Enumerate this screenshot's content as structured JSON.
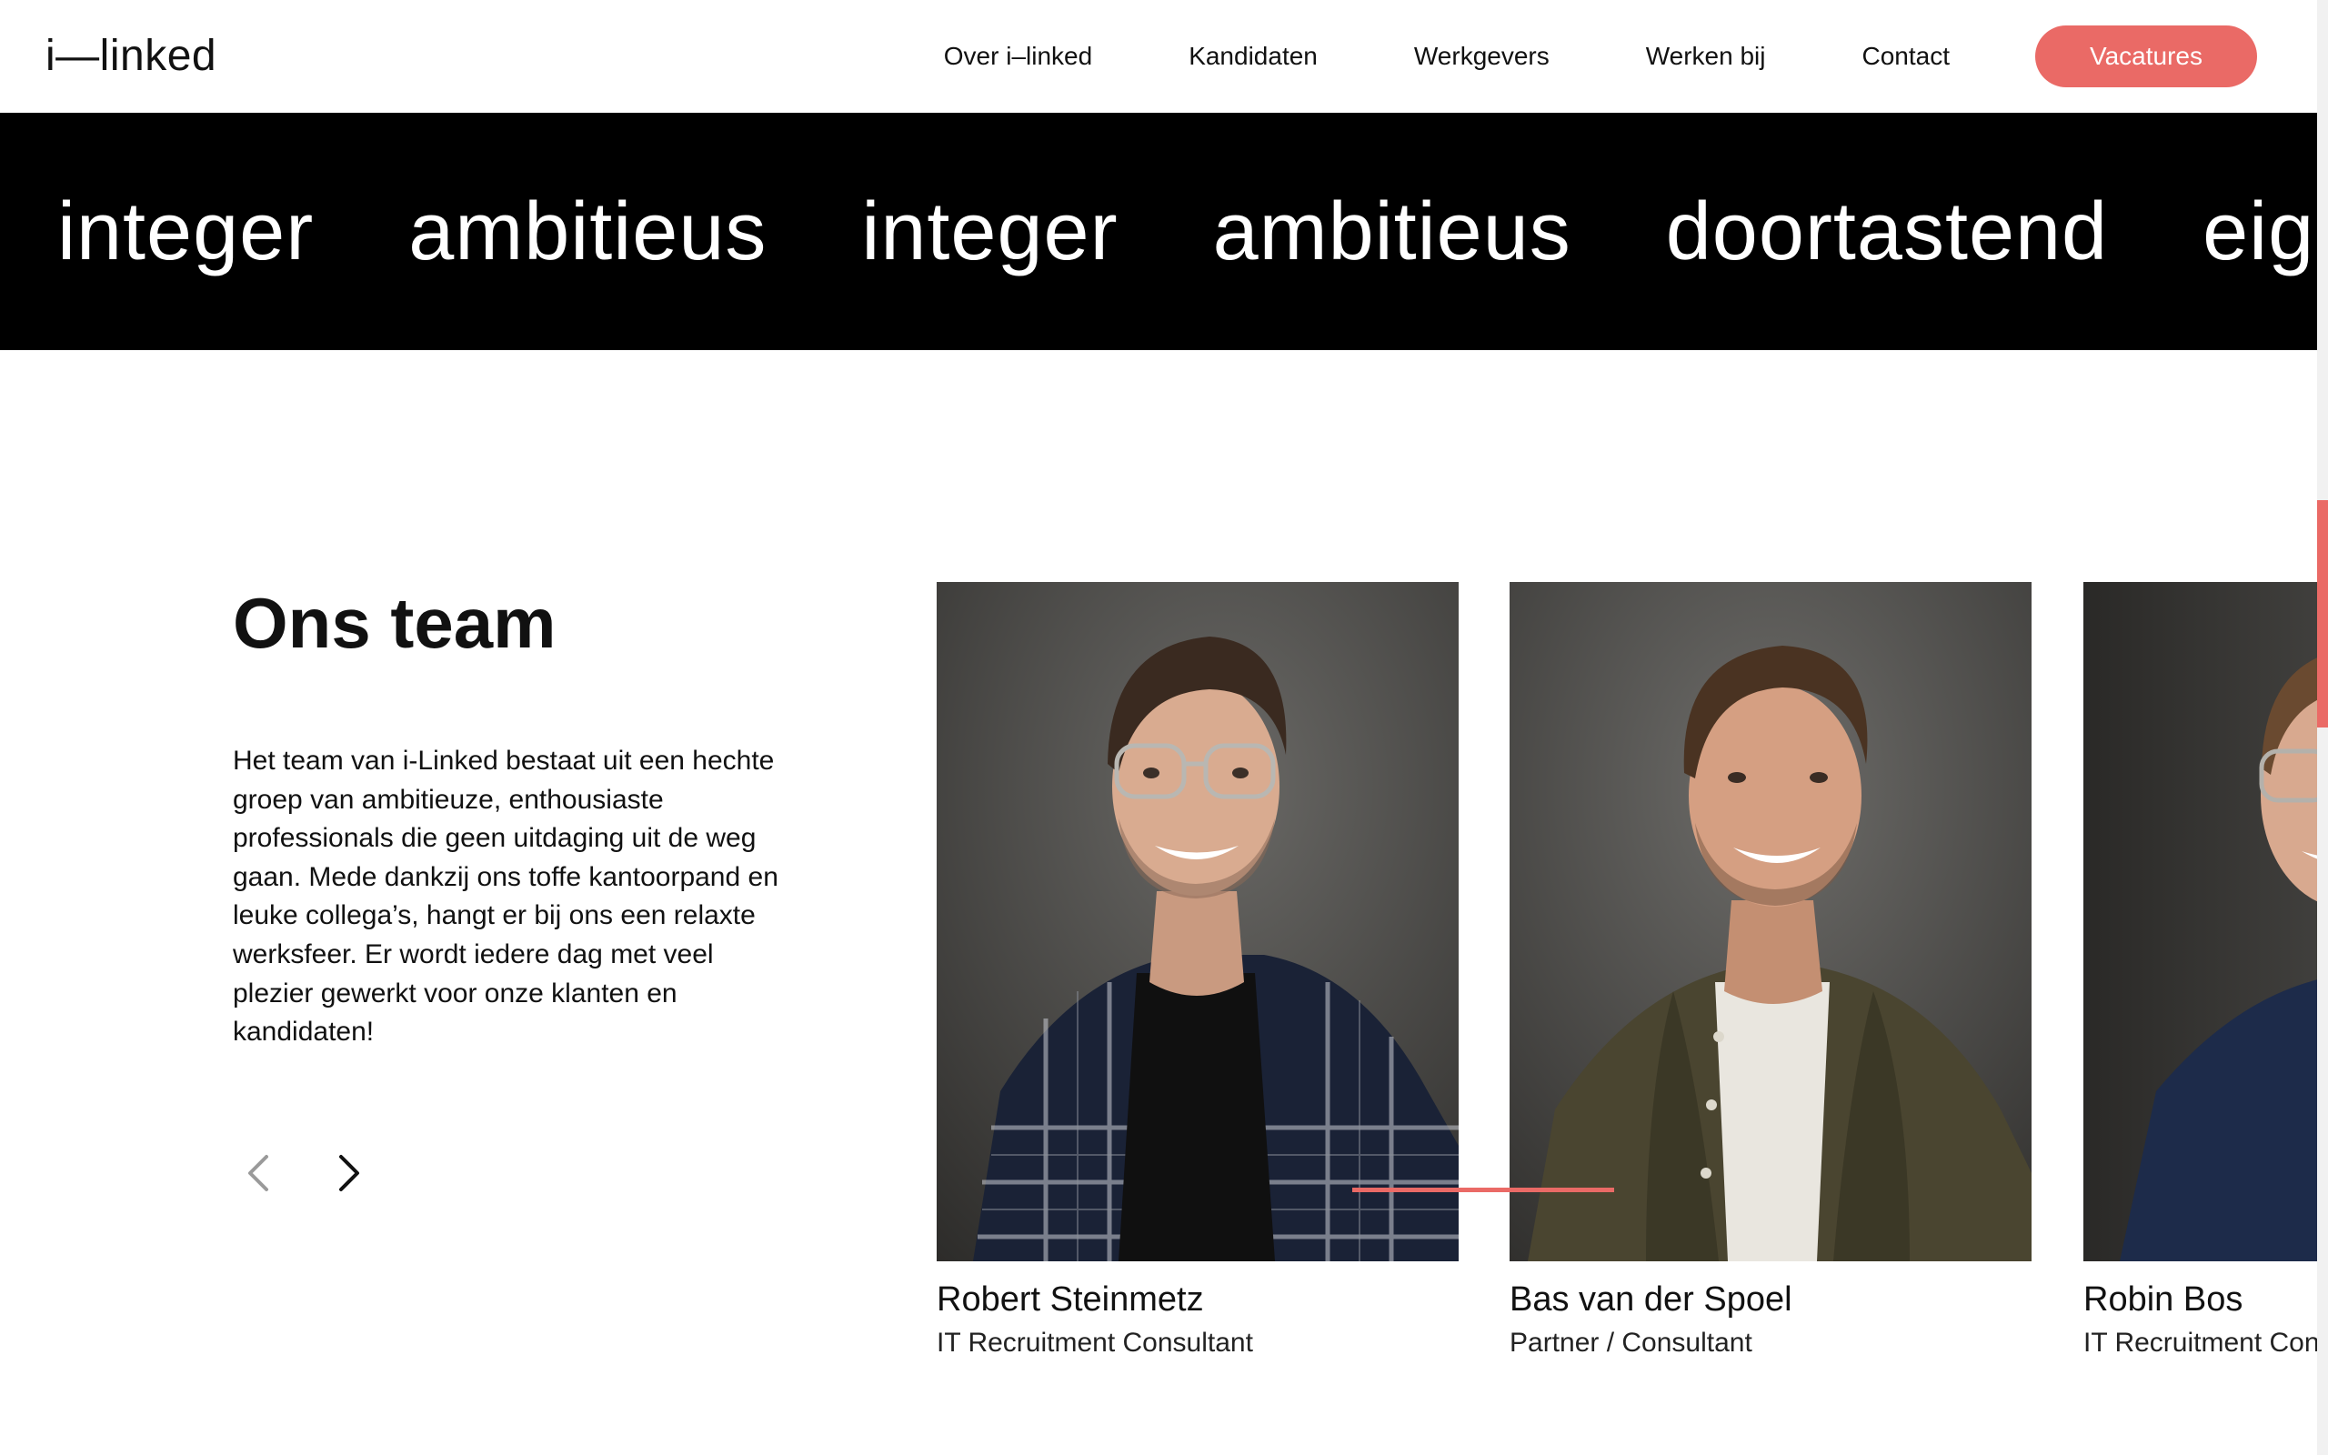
{
  "header": {
    "logo": "i—linked",
    "nav": [
      "Over i–linked",
      "Kandidaten",
      "Werkgevers",
      "Werken bij",
      "Contact"
    ],
    "cta": "Vacatures"
  },
  "values_marquee": [
    "integer",
    "ambitieus",
    "integer",
    "ambitieus",
    "doortastend",
    "eigenwijs"
  ],
  "team": {
    "title": "Ons team",
    "description": "Het team van i-Linked bestaat uit een hechte groep van ambitieuze, enthousiaste professionals die geen uitdaging uit de weg gaan. Mede dankzij ons toffe kantoorpand en leuke collega’s, hangt er bij ons een relaxte werksfeer. Er wordt iedere dag met veel plezier gewerkt voor onze klanten en kandidaten!",
    "members": [
      {
        "name": "Robert Steinmetz",
        "role": "IT Recruitment Consultant"
      },
      {
        "name": "Bas van der Spoel",
        "role": "Partner / Consultant"
      },
      {
        "name": "Robin Bos",
        "role": "IT Recruitment Consultant"
      }
    ],
    "carousel_progress": 0.33
  },
  "colors": {
    "accent": "#ea6a66",
    "text": "#111111",
    "band": "#000000",
    "background": "#ffffff"
  },
  "icons": [
    "chevron-left-icon",
    "chevron-right-icon"
  ]
}
